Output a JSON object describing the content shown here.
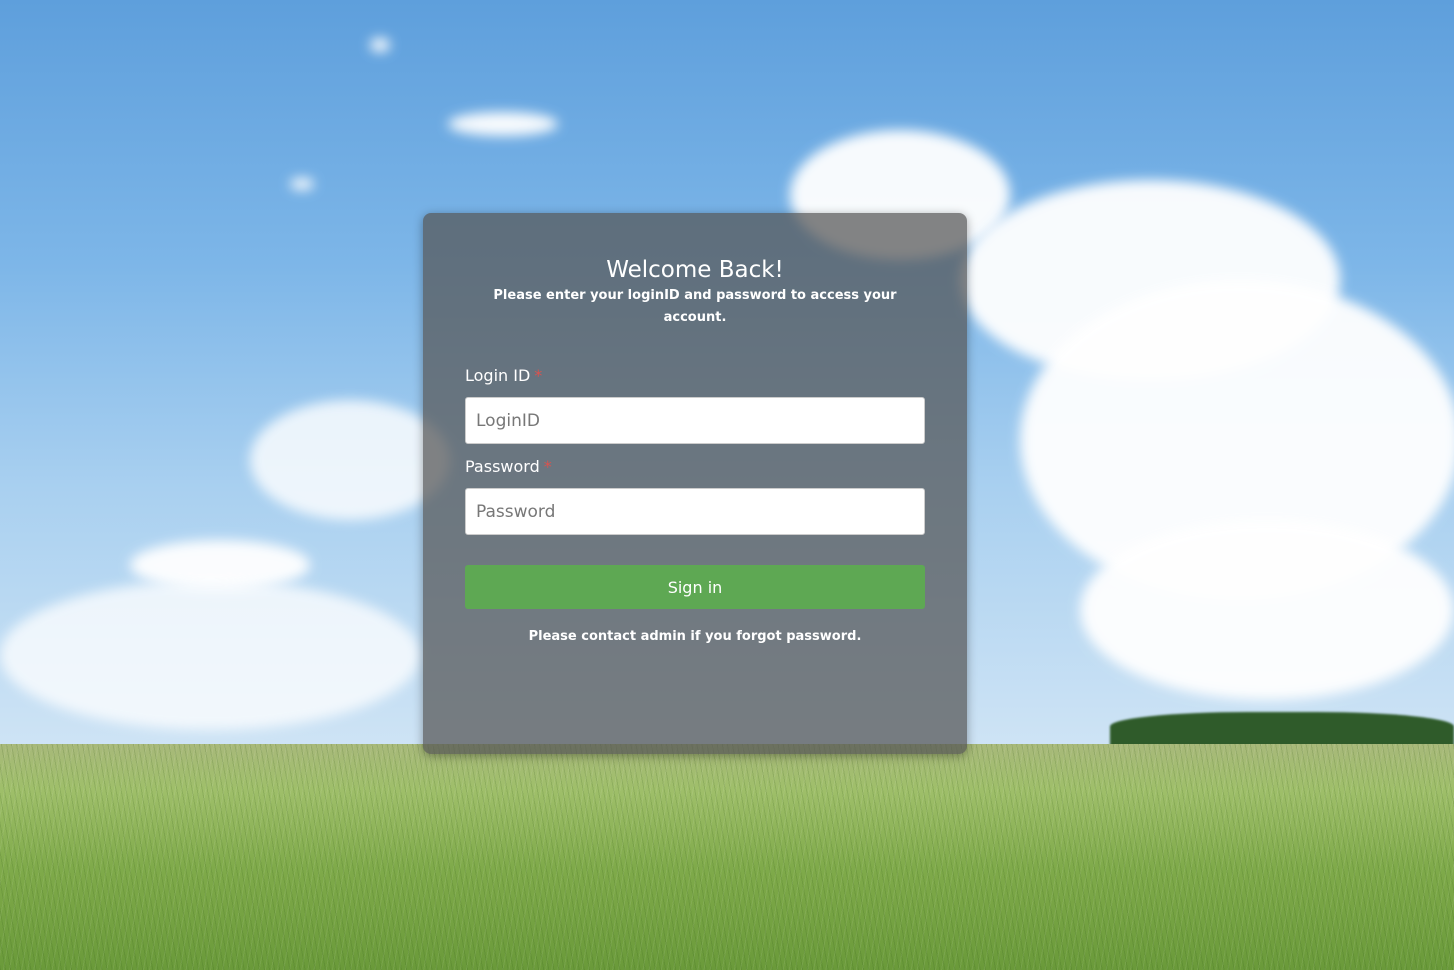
{
  "login": {
    "title": "Welcome Back!",
    "subtitle": "Please enter your loginID and password to access your account.",
    "login_id_label": "Login ID",
    "login_id_placeholder": "LoginID",
    "login_id_value": "",
    "password_label": "Password",
    "password_placeholder": "Password",
    "password_value": "",
    "required_marker": "*",
    "signin_label": "Sign in",
    "forgot_note": "Please contact admin if you forgot password."
  },
  "colors": {
    "button": "#5ea853",
    "required": "#d9534f",
    "card": "rgba(85,85,85,0.72)"
  }
}
